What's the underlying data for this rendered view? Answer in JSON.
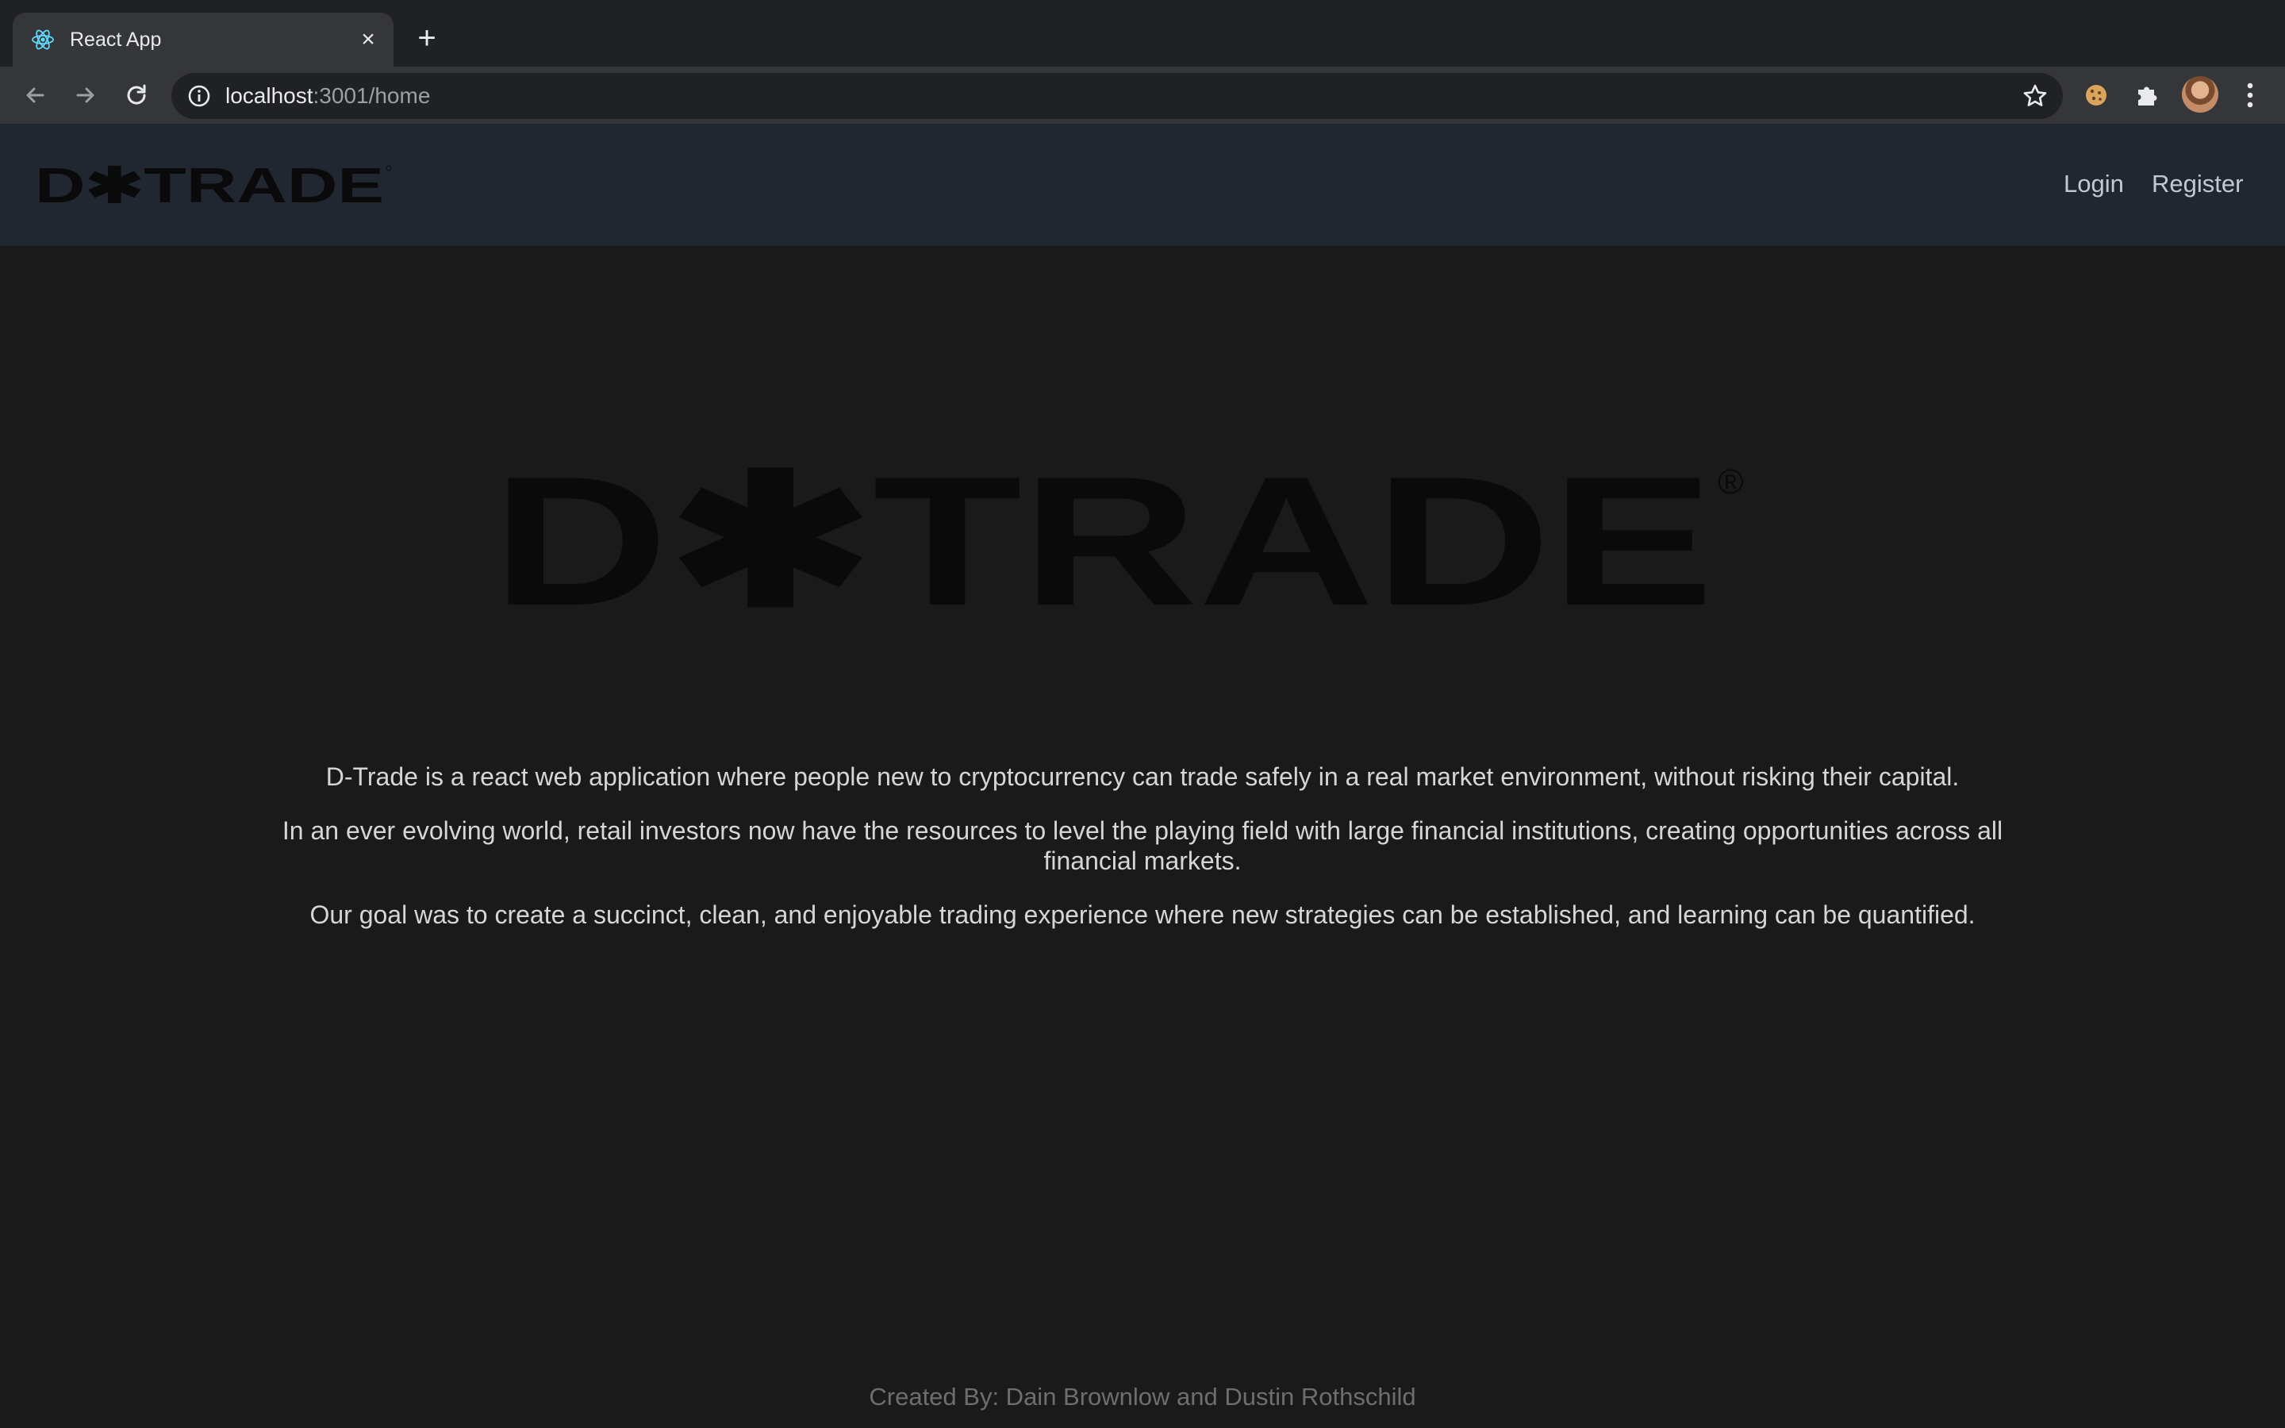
{
  "browser": {
    "tab": {
      "title": "React App",
      "favicon": "react-atom-icon"
    },
    "address_bar": {
      "host": "localhost",
      "rest": ":3001/home"
    },
    "icons": [
      "back-arrow-icon",
      "forward-arrow-icon",
      "reload-icon",
      "info-icon",
      "star-icon",
      "cookie-extension-icon",
      "puzzle-extension-icon",
      "menu-dots-icon"
    ]
  },
  "navbar": {
    "logo_text": "D✱TRADE",
    "links": {
      "login": "Login",
      "register": "Register"
    }
  },
  "hero": {
    "logo_text": "D✱TRADE",
    "registered_mark": "®"
  },
  "about": {
    "p1": "D-Trade is a react web application where people new to cryptocurrency can trade safely in a real market environment, without risking their capital.",
    "p2": "In an ever evolving world, retail investors now have the resources to level the playing field with large financial institutions, creating opportunities across all financial markets.",
    "p3": "Our goal was to create a succinct, clean, and enjoyable trading experience where new strategies can be established, and learning can be quantified."
  },
  "footer": {
    "credits": "Created By: Dain Brownlow and Dustin Rothschild"
  },
  "colors": {
    "page_bg": "#1a1a1a",
    "navbar_bg": "#212731",
    "logo": "#0a0a0a",
    "text": "#d6d6d6",
    "footer_text": "#6e6e6e"
  }
}
